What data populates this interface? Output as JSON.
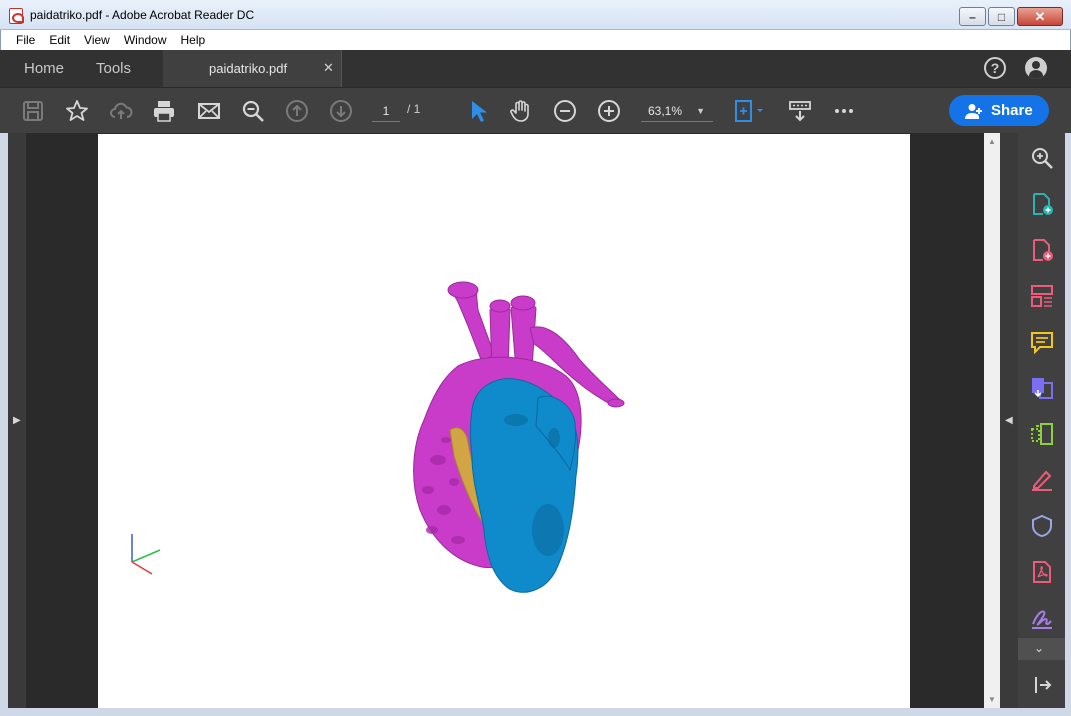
{
  "window": {
    "title": "paidatriko.pdf - Adobe Acrobat Reader DC",
    "minimize_glyph": "–",
    "maximize_glyph": "□",
    "close_glyph": "✕"
  },
  "menu": [
    "File",
    "Edit",
    "View",
    "Window",
    "Help"
  ],
  "tabs": {
    "home": "Home",
    "tools": "Tools",
    "document": "paidatriko.pdf",
    "document_close": "✕"
  },
  "header_icons": {
    "help": "?",
    "account": "user-icon"
  },
  "toolbar": {
    "page_current": "1",
    "page_total": "/ 1",
    "zoom": "63,1%",
    "zoom_caret": "▼",
    "share_label": "Share"
  },
  "panels": {
    "left_arrow": "▶",
    "right_arrow": "◀",
    "more_chevron": "⌄",
    "scroll_up": "▲",
    "scroll_down": "▼"
  },
  "colors": {
    "accent": "#1473e6",
    "heart_magenta": "#c93bc9",
    "heart_blue": "#0f8bcc",
    "heart_gold": "#d1a444"
  }
}
